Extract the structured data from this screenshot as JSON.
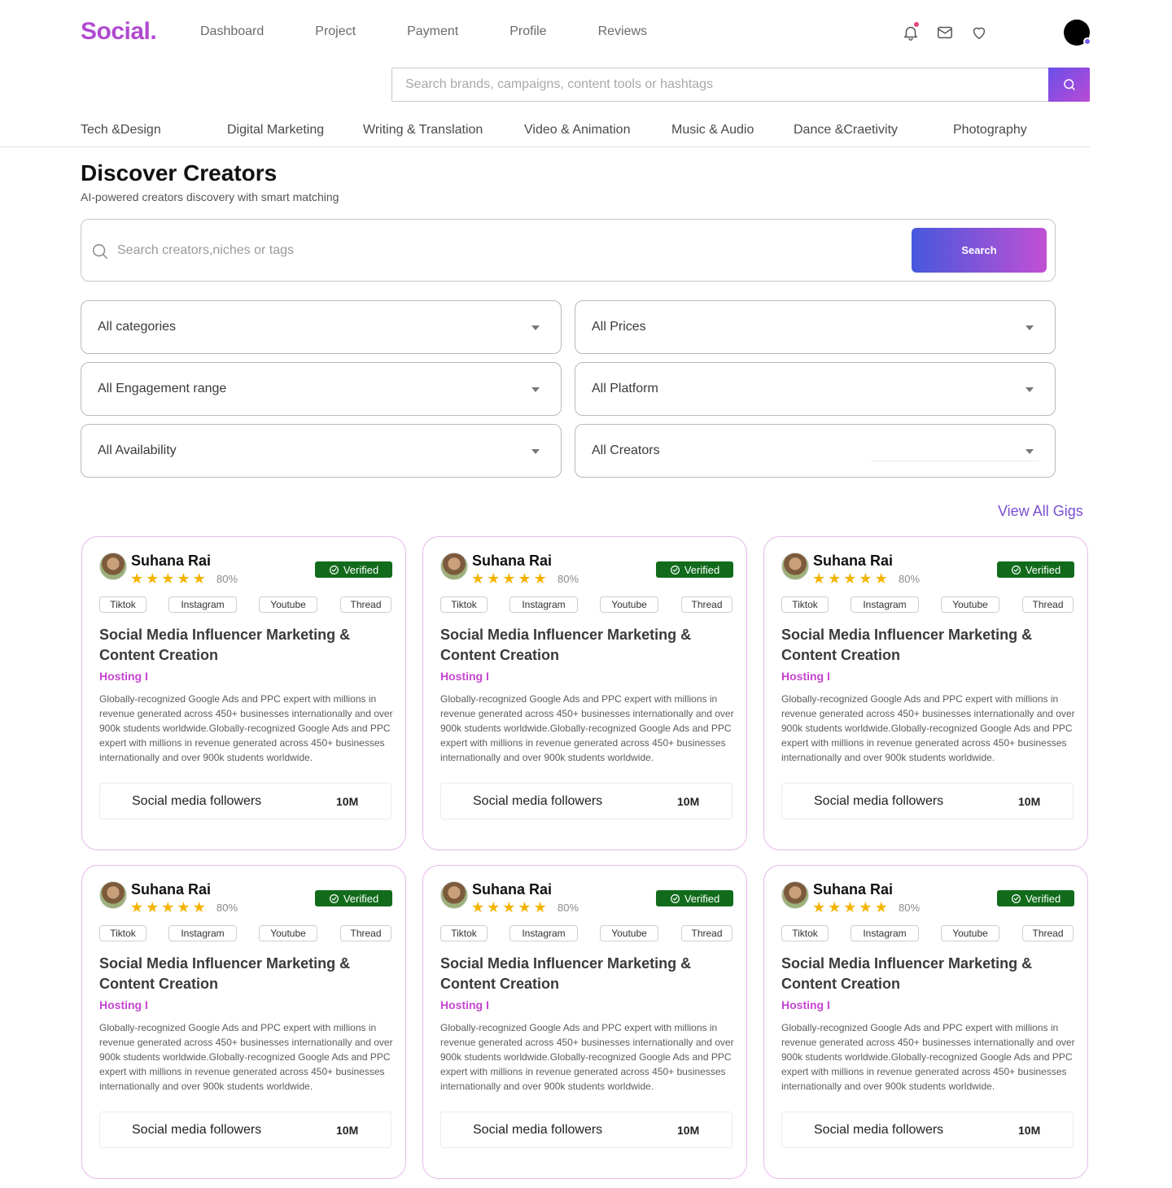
{
  "header": {
    "logo": "Social.",
    "nav": [
      "Dashboard",
      "Project",
      "Payment",
      "Profile",
      "Reviews"
    ],
    "icons": [
      "bell-icon",
      "mail-icon",
      "heart-icon"
    ],
    "search_placeholder": "Search brands, campaigns, content tools or hashtags"
  },
  "categories": [
    "Tech &Design",
    "Digital Marketing",
    "Writing & Translation",
    "Video & Animation",
    "Music & Audio",
    "Dance &Craetivity",
    "Photography"
  ],
  "discover": {
    "title": "Discover Creators",
    "subtitle": "AI-powered creators discovery with smart matching",
    "search_placeholder": "Search creators,niches or tags",
    "search_button": "Search"
  },
  "filters": [
    "All categories",
    "All Prices",
    "All Engagement range",
    "All Platform",
    "All Availability",
    "All Creators"
  ],
  "view_all": "View All Gigs",
  "colors": {
    "brand": "#b04ad0",
    "accent": "#7a4fd1",
    "verified": "#116b1b",
    "star": "#f5b301",
    "host": "#c545cf"
  },
  "cards": [
    {
      "name": "Suhana Rai",
      "rating": "80%",
      "stars": 5,
      "verified": "Verified",
      "tags": [
        "Tiktok",
        "Instagram",
        "Youtube",
        "Thread"
      ],
      "title": "Social Media Influencer Marketing & Content Creation",
      "host": "Hosting I",
      "desc": "Globally-recognized Google Ads and PPC expert with millions in revenue generated across 450+ businesses internationally and over 900k students worldwide.Globally-recognized Google Ads and PPC expert with millions in revenue generated across 450+ businesses internationally and over 900k students worldwide.",
      "followers_label": "Social media followers",
      "followers_value": "10M"
    },
    {
      "name": "Suhana Rai",
      "rating": "80%",
      "stars": 5,
      "verified": "Verified",
      "tags": [
        "Tiktok",
        "Instagram",
        "Youtube",
        "Thread"
      ],
      "title": "Social Media Influencer Marketing & Content Creation",
      "host": "Hosting I",
      "desc": "Globally-recognized Google Ads and PPC expert with millions in revenue generated across 450+ businesses internationally and over 900k students worldwide.Globally-recognized Google Ads and PPC expert with millions in revenue generated across 450+ businesses internationally and over 900k students worldwide.",
      "followers_label": "Social media followers",
      "followers_value": "10M"
    },
    {
      "name": "Suhana Rai",
      "rating": "80%",
      "stars": 5,
      "verified": "Verified",
      "tags": [
        "Tiktok",
        "Instagram",
        "Youtube",
        "Thread"
      ],
      "title": "Social Media Influencer Marketing & Content Creation",
      "host": "Hosting I",
      "desc": "Globally-recognized Google Ads and PPC expert with millions in revenue generated across 450+ businesses internationally and over 900k students worldwide.Globally-recognized Google Ads and PPC expert with millions in revenue generated across 450+ businesses internationally and over 900k students worldwide.",
      "followers_label": "Social media followers",
      "followers_value": "10M"
    },
    {
      "name": "Suhana Rai",
      "rating": "80%",
      "stars": 5,
      "verified": "Verified",
      "tags": [
        "Tiktok",
        "Instagram",
        "Youtube",
        "Thread"
      ],
      "title": "Social Media Influencer Marketing & Content Creation",
      "host": "Hosting I",
      "desc": "Globally-recognized Google Ads and PPC expert with millions in revenue generated across 450+ businesses internationally and over 900k students worldwide.Globally-recognized Google Ads and PPC expert with millions in revenue generated across 450+ businesses internationally and over 900k students worldwide.",
      "followers_label": "Social media followers",
      "followers_value": "10M"
    },
    {
      "name": "Suhana Rai",
      "rating": "80%",
      "stars": 5,
      "verified": "Verified",
      "tags": [
        "Tiktok",
        "Instagram",
        "Youtube",
        "Thread"
      ],
      "title": "Social Media Influencer Marketing & Content Creation",
      "host": "Hosting I",
      "desc": "Globally-recognized Google Ads and PPC expert with millions in revenue generated across 450+ businesses internationally and over 900k students worldwide.Globally-recognized Google Ads and PPC expert with millions in revenue generated across 450+ businesses internationally and over 900k students worldwide.",
      "followers_label": "Social media followers",
      "followers_value": "10M"
    },
    {
      "name": "Suhana Rai",
      "rating": "80%",
      "stars": 5,
      "verified": "Verified",
      "tags": [
        "Tiktok",
        "Instagram",
        "Youtube",
        "Thread"
      ],
      "title": "Social Media Influencer Marketing & Content Creation",
      "host": "Hosting I",
      "desc": "Globally-recognized Google Ads and PPC expert with millions in revenue generated across 450+ businesses internationally and over 900k students worldwide.Globally-recognized Google Ads and PPC expert with millions in revenue generated across 450+ businesses internationally and over 900k students worldwide.",
      "followers_label": "Social media followers",
      "followers_value": "10M"
    }
  ]
}
